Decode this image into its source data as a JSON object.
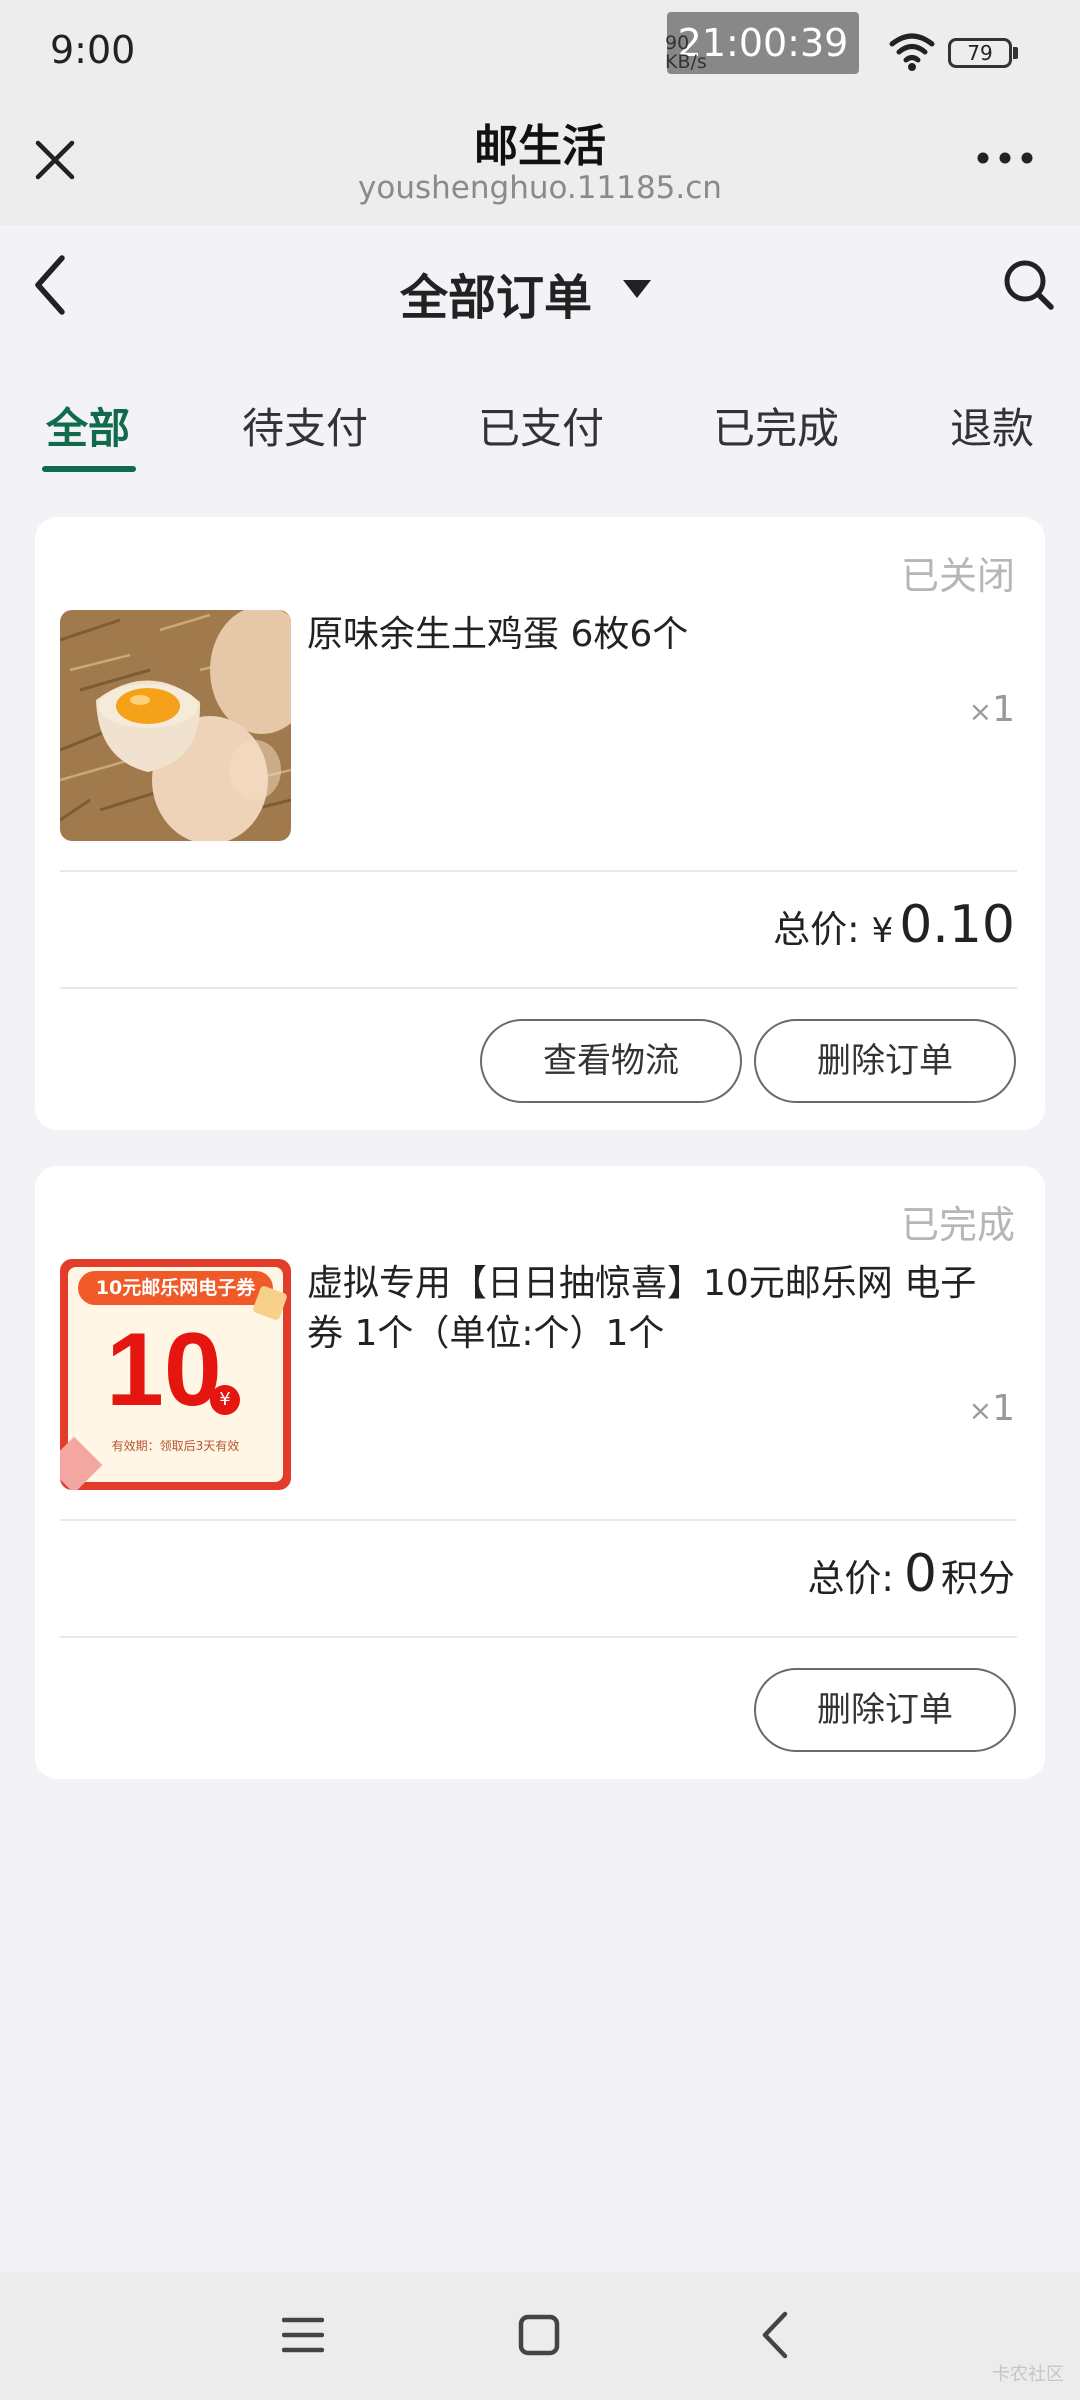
{
  "status_bar": {
    "time": "9:00",
    "overlay_clock": "21:00:39",
    "net_speed_value": "90",
    "net_speed_unit": "KB/s",
    "battery": "79"
  },
  "mini_program": {
    "title": "邮生活",
    "url": "youshenghuo.11185.cn"
  },
  "header": {
    "title": "全部订单"
  },
  "tabs": [
    {
      "label": "全部",
      "active": true
    },
    {
      "label": "待支付"
    },
    {
      "label": "已支付"
    },
    {
      "label": "已完成"
    },
    {
      "label": "退款"
    }
  ],
  "orders": [
    {
      "status": "已关闭",
      "product_name": "原味余生土鸡蛋 6枚6个",
      "qty_x": "×",
      "qty": "1",
      "total_label": "总价:",
      "currency": "¥",
      "total_value": "0.10",
      "buttons": [
        "查看物流",
        "删除订单"
      ]
    },
    {
      "status": "已完成",
      "product_name": "虚拟专用【日日抽惊喜】10元邮乐网 电子券 1个（单位:个）1个",
      "qty_x": "×",
      "qty": "1",
      "total_label": "总价:",
      "total_value": "0",
      "total_unit": "积分",
      "buttons": [
        "删除订单"
      ],
      "coupon": {
        "banner": "10元邮乐网电子券",
        "amount": "10",
        "yen": "¥",
        "validity": "有效期：领取后3天有效"
      }
    }
  ],
  "watermark": "卡农社区",
  "colors": {
    "accent": "#0f6b4b",
    "background": "#f3f3f7",
    "coupon_red": "#e23d2b"
  }
}
